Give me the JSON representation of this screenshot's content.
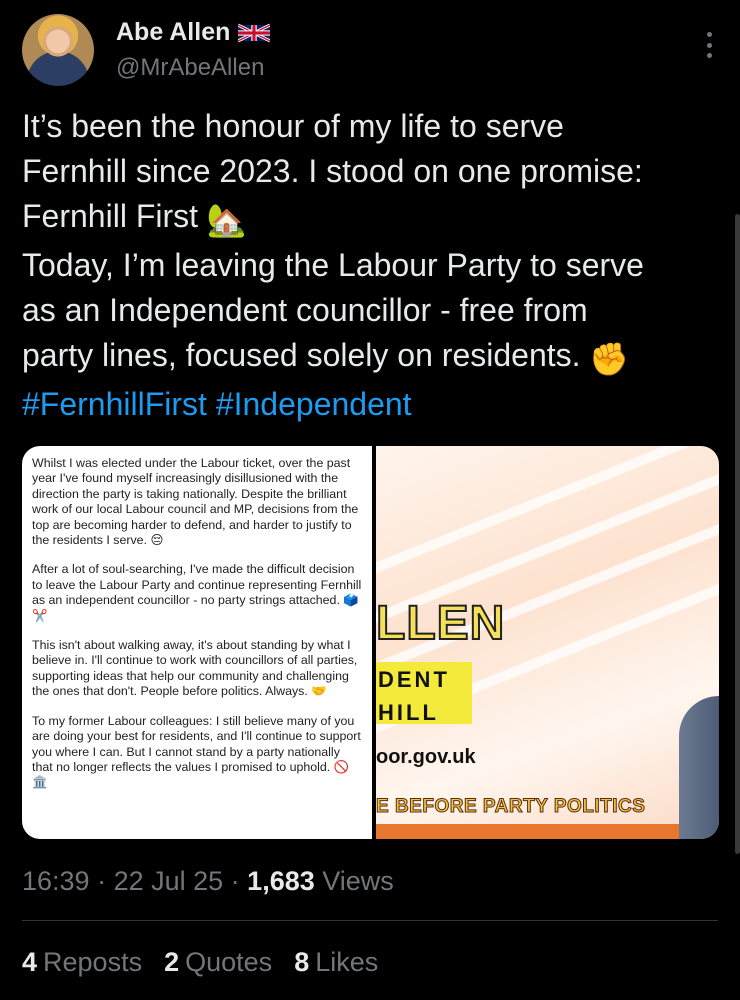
{
  "author": {
    "name": "Abe Allen",
    "handle": "@MrAbeAllen",
    "flag_icon": "uk-flag-icon"
  },
  "tweet": {
    "lines": [
      "It’s been the honour of my life to serve",
      "Fernhill since 2023. I stood on one promise:",
      "Fernhill First",
      "Today, I’m leaving the Labour Party to serve",
      "as an Independent councillor - free from",
      "party lines, focused solely on residents."
    ],
    "emoji_house": "🏡",
    "emoji_fist": "✊",
    "hashtags": [
      "#FernhillFirst",
      "#Independent"
    ]
  },
  "media": {
    "left_paragraphs": [
      "Whilst I was elected under the Labour ticket, over the past year I've found myself increasingly disillusioned with the direction the party is taking nationally. Despite the brilliant work of our local Labour council and MP, decisions from the top are becoming harder to defend, and harder to justify to the residents I serve. 😔",
      "After a lot of soul-searching, I've made the difficult decision to leave the Labour Party and continue representing Fernhill as an independent councillor - no party strings attached. 🗳️✂️",
      "This isn't about walking away, it's about standing by what I believe in. I'll continue to work with councillors of all parties, supporting ideas that help our community and challenging the ones that don't. People before politics. Always. 🤝",
      "To my former Labour colleagues: I still believe many of you are doing your best for residents, and I'll continue to support you where I can. But I cannot stand by a party nationally that no longer reflects the values I promised to uphold. 🚫🏛️"
    ],
    "right_title": "LLEN",
    "right_line1": "DENT",
    "right_line2": "HILL",
    "right_url": "oor.gov.uk",
    "right_slogan": "E BEFORE PARTY POLITICS"
  },
  "meta": {
    "time": "16:39",
    "date": "22 Jul 25",
    "views_count": "1,683",
    "views_label": "Views"
  },
  "stats": {
    "reposts_count": "4",
    "reposts_label": "Reposts",
    "quotes_count": "2",
    "quotes_label": "Quotes",
    "likes_count": "8",
    "likes_label": "Likes"
  },
  "colors": {
    "background": "#000000",
    "text": "#e7e9ea",
    "muted": "#71767b",
    "accent": "#1d9bf0"
  }
}
